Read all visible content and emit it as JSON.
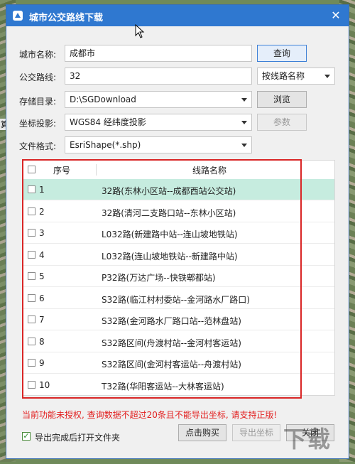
{
  "background": {
    "left_text": "算"
  },
  "window": {
    "title": "城市公交路线下载",
    "close_glyph": "✕"
  },
  "form": {
    "city": {
      "label": "城市名称:",
      "value": "成都市",
      "button": "查询"
    },
    "line": {
      "label": "公交路线:",
      "value": "32",
      "mode": "按线路名称"
    },
    "dir": {
      "label": "存储目录:",
      "value": "D:\\SGDownload",
      "button": "浏览"
    },
    "proj": {
      "label": "坐标投影:",
      "value": "WGS84 经纬度投影",
      "button": "参数"
    },
    "fmt": {
      "label": "文件格式:",
      "value": "EsriShape(*.shp)"
    }
  },
  "table": {
    "headers": {
      "index": "序号",
      "name": "线路名称"
    },
    "rows": [
      {
        "num": "1",
        "name": "32路(东林小区站--成都西站公交站)"
      },
      {
        "num": "2",
        "name": "32路(清河二支路口站--东林小区站)"
      },
      {
        "num": "3",
        "name": "L032路(新建路中站--连山坡地铁站)"
      },
      {
        "num": "4",
        "name": "L032路(连山坡地铁站--新建路中站)"
      },
      {
        "num": "5",
        "name": "P32路(万达广场--快铁郫都站)"
      },
      {
        "num": "6",
        "name": "S32路(临江村村委站--金河路水厂路口)"
      },
      {
        "num": "7",
        "name": "S32路(金河路水厂路口站--范林盘站)"
      },
      {
        "num": "8",
        "name": "S32路区间(舟渡村站--金河村客运站)"
      },
      {
        "num": "9",
        "name": "S32路区间(金河村客运站--舟渡村站)"
      },
      {
        "num": "10",
        "name": "T32路(华阳客运站--大林客运站)"
      }
    ]
  },
  "footer": {
    "warning": "当前功能未授权, 查询数据不超过20条且不能导出坐标, 请支持正版!",
    "open_folder": "导出完成后打开文件夹",
    "buy": "点击购买",
    "export": "导出坐标",
    "close": "关闭"
  },
  "watermark": "下载"
}
